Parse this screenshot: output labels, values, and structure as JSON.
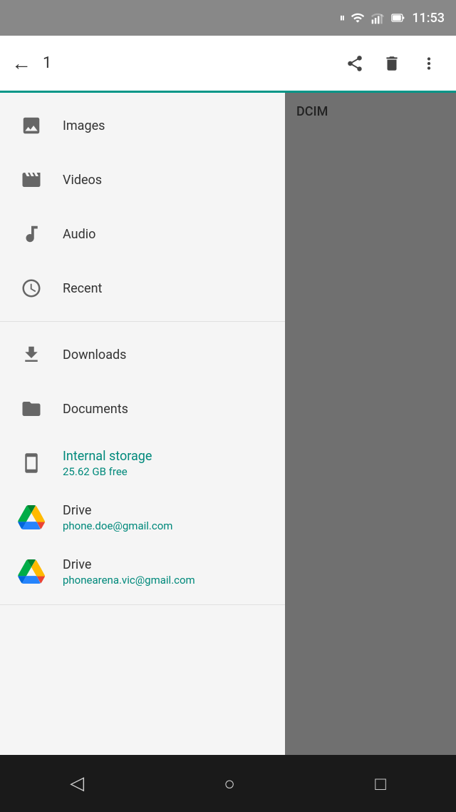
{
  "statusBar": {
    "time": "11:53",
    "icons": [
      "pause",
      "wifi",
      "signal",
      "battery"
    ]
  },
  "toolbar": {
    "title": "1",
    "backLabel": "←",
    "shareLabel": "share",
    "deleteLabel": "delete",
    "moreLabel": "more"
  },
  "drawer": {
    "sections": [
      {
        "items": [
          {
            "id": "images",
            "label": "Images",
            "icon": "image"
          },
          {
            "id": "videos",
            "label": "Videos",
            "icon": "video"
          },
          {
            "id": "audio",
            "label": "Audio",
            "icon": "audio"
          },
          {
            "id": "recent",
            "label": "Recent",
            "icon": "clock"
          }
        ]
      },
      {
        "items": [
          {
            "id": "downloads",
            "label": "Downloads",
            "icon": "download"
          },
          {
            "id": "documents",
            "label": "Documents",
            "icon": "folder"
          },
          {
            "id": "internal-storage",
            "label": "Internal storage",
            "sublabel": "25.62 GB free",
            "icon": "phone",
            "active": true
          },
          {
            "id": "drive-1",
            "label": "Drive",
            "sublabel": "phone.doe@gmail.com",
            "icon": "drive"
          },
          {
            "id": "drive-2",
            "label": "Drive",
            "sublabel": "phonearena.vic@gmail.com",
            "icon": "drive"
          }
        ]
      }
    ]
  },
  "rightPanel": {
    "folderName": "DCIM"
  },
  "navBar": {
    "back": "◁",
    "home": "○",
    "recent": "□"
  }
}
